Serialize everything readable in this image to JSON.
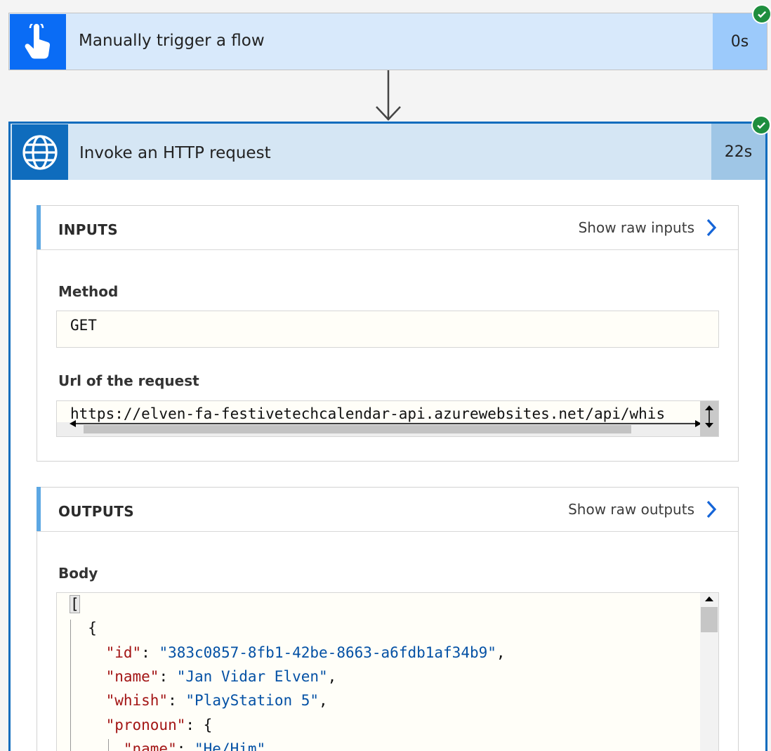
{
  "trigger": {
    "title": "Manually trigger a flow",
    "duration": "0s"
  },
  "action": {
    "title": "Invoke an HTTP request",
    "duration": "22s"
  },
  "inputs": {
    "header": "INPUTS",
    "raw_link": "Show raw inputs",
    "method_label": "Method",
    "method_value": "GET",
    "url_label": "Url of the request",
    "url_value": "https://elven-fa-festivetechcalendar-api.azurewebsites.net/api/whis"
  },
  "outputs": {
    "header": "OUTPUTS",
    "raw_link": "Show raw outputs",
    "body_label": "Body",
    "json_lines": [
      {
        "indent": "",
        "tokens": [
          [
            "p",
            "["
          ]
        ]
      },
      {
        "indent": "  ",
        "tokens": [
          [
            "p",
            "{"
          ]
        ]
      },
      {
        "indent": "    ",
        "tokens": [
          [
            "k",
            "\"id\""
          ],
          [
            "p",
            ": "
          ],
          [
            "s",
            "\"383c0857-8fb1-42be-8663-a6fdb1af34b9\""
          ],
          [
            "p",
            ","
          ]
        ]
      },
      {
        "indent": "    ",
        "tokens": [
          [
            "k",
            "\"name\""
          ],
          [
            "p",
            ": "
          ],
          [
            "s",
            "\"Jan Vidar Elven\""
          ],
          [
            "p",
            ","
          ]
        ]
      },
      {
        "indent": "    ",
        "tokens": [
          [
            "k",
            "\"whish\""
          ],
          [
            "p",
            ": "
          ],
          [
            "s",
            "\"PlayStation 5\""
          ],
          [
            "p",
            ","
          ]
        ]
      },
      {
        "indent": "    ",
        "tokens": [
          [
            "k",
            "\"pronoun\""
          ],
          [
            "p",
            ": {"
          ]
        ]
      },
      {
        "indent": "      ",
        "tokens": [
          [
            "k",
            "\"name\""
          ],
          [
            "p",
            ": "
          ],
          [
            "s",
            "\"He/Him\""
          ]
        ]
      }
    ]
  },
  "colors": {
    "accent": "#0f6cbd",
    "success": "#1e8e3e"
  }
}
